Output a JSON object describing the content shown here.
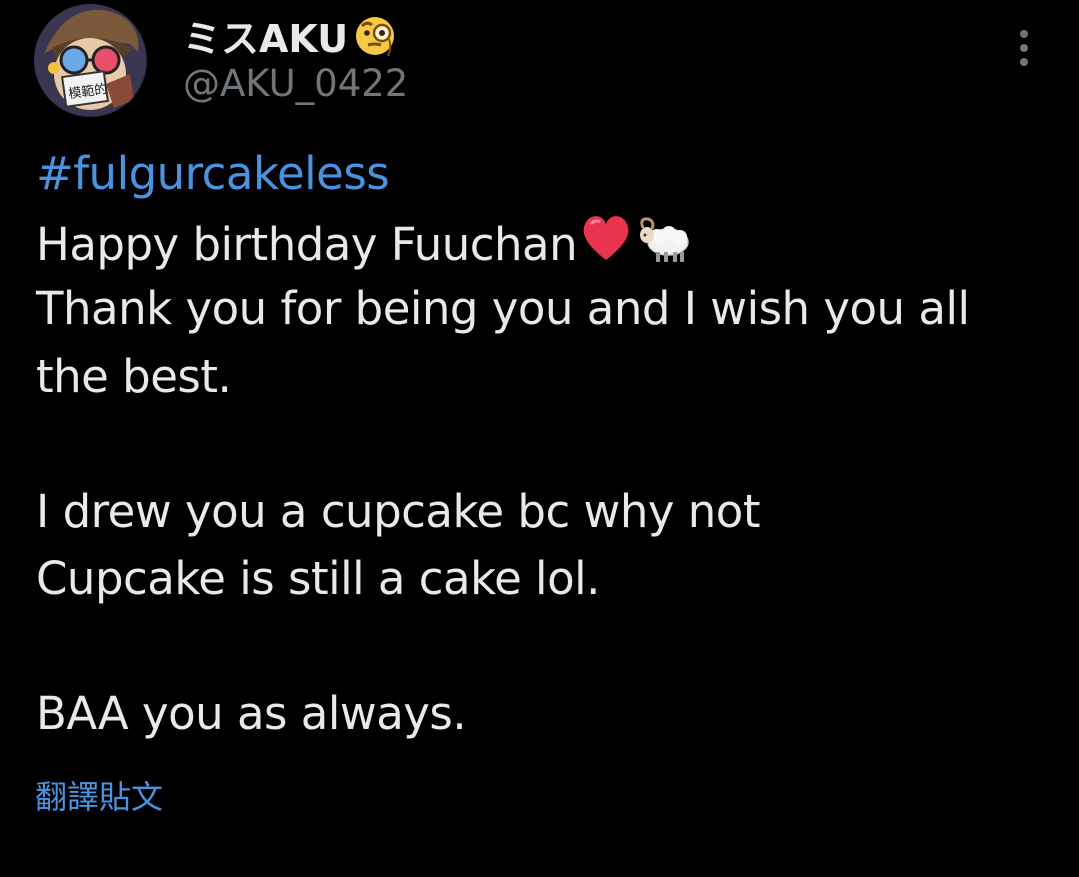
{
  "post": {
    "author": {
      "display_name": "ミスAKU",
      "name_emoji": "monocle-face-emoji",
      "handle": "@AKU_0422",
      "avatar_text": "模範的"
    },
    "menu_icon": "more-vertical-icon",
    "body": {
      "hashtag": "#fulgurcakeless",
      "line1": "Happy birthday Fuuchan",
      "line1_emojis": [
        "red-heart-emoji",
        "ram-emoji"
      ],
      "line2": "Thank you for being you and I wish you all",
      "line3": "the best.",
      "line4": "I drew you a cupcake bc why not",
      "line5": "Cupcake is still a cake lol.",
      "line6": "BAA you as always."
    },
    "translate_label": "翻譯貼文"
  },
  "colors": {
    "background": "#000000",
    "text": "#e7e9ea",
    "secondary": "#71767b",
    "link": "#4a93e0"
  }
}
